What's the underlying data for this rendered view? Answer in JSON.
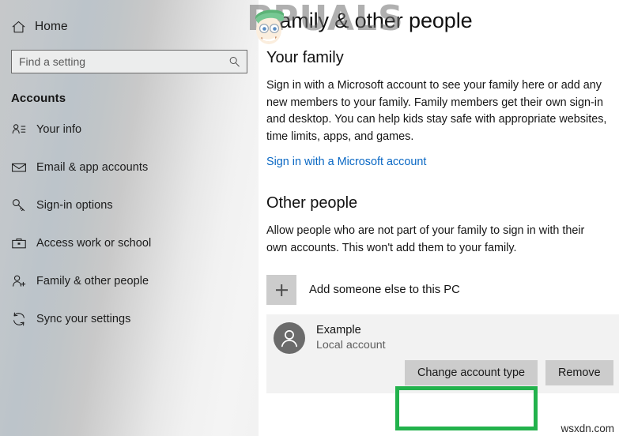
{
  "sidebar": {
    "home": {
      "label": "Home",
      "icon": "home-icon"
    },
    "search": {
      "placeholder": "Find a setting",
      "value": "",
      "icon": "search-icon"
    },
    "section_title": "Accounts",
    "items": [
      {
        "label": "Your info",
        "icon": "person-list-icon"
      },
      {
        "label": "Email & app accounts",
        "icon": "envelope-icon"
      },
      {
        "label": "Sign-in options",
        "icon": "key-icon"
      },
      {
        "label": "Access work or school",
        "icon": "briefcase-icon"
      },
      {
        "label": "Family & other people",
        "icon": "person-add-icon"
      },
      {
        "label": "Sync your settings",
        "icon": "sync-icon"
      }
    ]
  },
  "main": {
    "page_title": "Family & other people",
    "your_family": {
      "heading": "Your family",
      "paragraph_lines": [
        "Sign in with a Microsoft account to see your family here or add any",
        "new members to your family. Family members get their own sign-in",
        "and desktop. You can help kids stay safe with appropriate websites,",
        "time limits, apps, and games."
      ],
      "link": "Sign in with a Microsoft account"
    },
    "other_people": {
      "heading": "Other people",
      "paragraph_lines": [
        "Allow people who are not part of your family to sign in with their",
        "own accounts. This won't add them to your family."
      ],
      "add_button": {
        "label": "Add someone else to this PC",
        "icon": "plus-icon"
      },
      "account": {
        "name": "Example",
        "type": "Local account",
        "avatar_icon": "person-icon",
        "actions": [
          {
            "label": "Change account type",
            "highlighted": true
          },
          {
            "label": "Remove",
            "highlighted": false
          }
        ]
      }
    }
  },
  "watermarks": {
    "brand": "PPUALS",
    "site": "wsxdn.com"
  },
  "colors": {
    "link": "#0a68c4",
    "annotation": "#22b24c",
    "button": "#cccccc",
    "selected_row": "#f2f2f2"
  }
}
